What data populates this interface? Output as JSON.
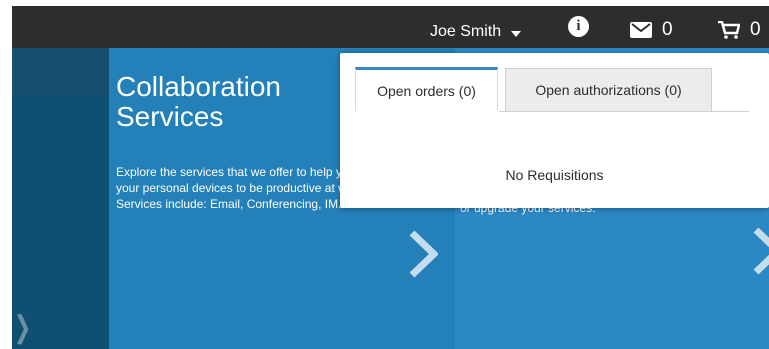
{
  "header": {
    "user_name": "Joe Smith",
    "messages_count": "0",
    "cart_count": "0"
  },
  "cards": [
    {
      "title_line1": "Collaboration",
      "title_line2": "Services",
      "description": "Explore the services that we offer to help you use your personal devices to be productive at work. Services include: Email, Conferencing, IM."
    },
    {
      "description": "services, access your order history, get analytics on currently active services, and take action to maintain or upgrade your services."
    }
  ],
  "popover": {
    "tabs": [
      {
        "label": "Open orders (0)",
        "active": true
      },
      {
        "label": "Open authorizations (0)",
        "active": false
      }
    ],
    "empty_message": "No Requisitions"
  },
  "colors": {
    "topbar": "#2d2d2d",
    "hero": "#2380b8",
    "tab_accent": "#3a86c4"
  }
}
